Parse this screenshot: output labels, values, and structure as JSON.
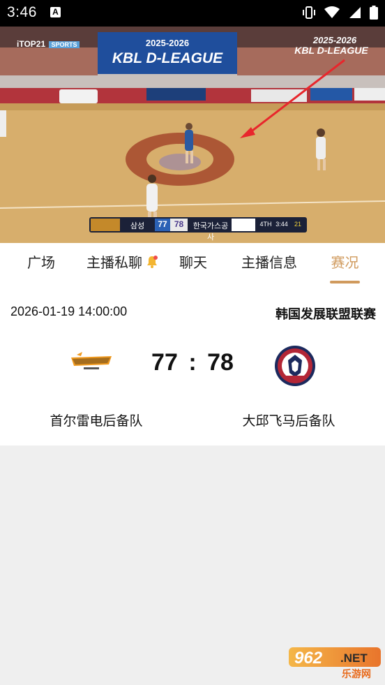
{
  "status_bar": {
    "time": "3:46",
    "notification_icon": "A"
  },
  "video": {
    "badge_left": "iTOP21",
    "badge_left_sub": "SPORTS",
    "banner_year": "2025-2026",
    "banner_title": "KBL D-LEAGUE",
    "corner_year": "2025-2026",
    "corner_title": "KBL D-LEAGUE",
    "scoreboard": {
      "home_abbr": "삼성",
      "home_score": "77",
      "away_score": "78",
      "away_abbr": "한국가스공사",
      "quarter": "4TH",
      "clock": "3:44",
      "shot_clock": "21"
    }
  },
  "tabs": [
    {
      "label": "广场",
      "active": false
    },
    {
      "label": "主播私聊",
      "active": false
    },
    {
      "label": "聊天",
      "active": false
    },
    {
      "label": "主播信息",
      "active": false
    },
    {
      "label": "赛况",
      "active": true
    }
  ],
  "match": {
    "datetime": "2026-01-19 14:00:00",
    "league": "韩国发展联盟联赛",
    "home_score": "77",
    "separator": ":",
    "away_score": "78",
    "home_team": "首尔雷电后备队",
    "away_team": "大邱飞马后备队"
  },
  "watermark": {
    "main": "962",
    "suffix": ".NET",
    "sub": "乐游网"
  },
  "colors": {
    "accent": "#d09a5d",
    "status_bar": "#000000",
    "background": "#efefef"
  }
}
